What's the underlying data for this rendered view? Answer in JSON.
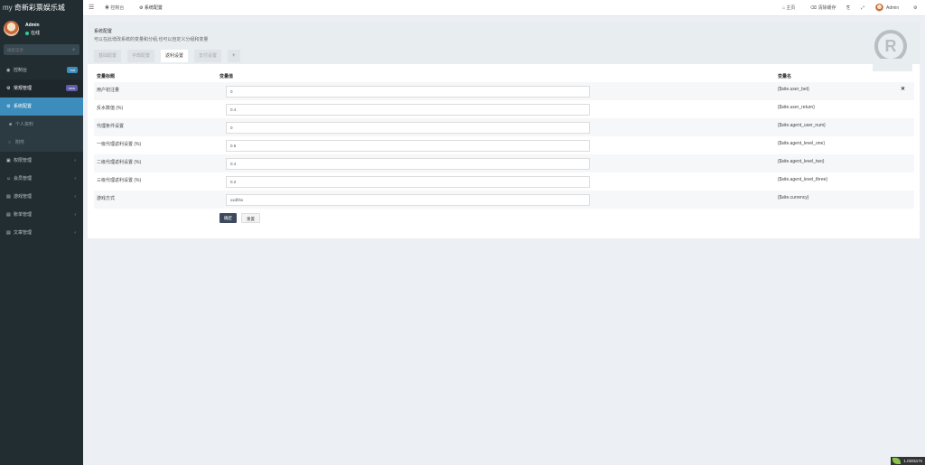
{
  "sidebar": {
    "logo_prefix": "my",
    "logo_text": "奇新彩票娱乐城",
    "user": {
      "name": "Admin",
      "status": "在线"
    },
    "search_placeholder": "搜索菜单",
    "items": [
      {
        "label": "控制台",
        "icon": "dashboard-icon",
        "badge": "hot",
        "badge_color": "#3c8dbc"
      },
      {
        "label": "常规管理",
        "icon": "cogs-icon",
        "badge": "new",
        "badge_color": "#605ca8"
      },
      {
        "label": "系统配置",
        "icon": "gear-icon"
      },
      {
        "label": "个人资料",
        "icon": "user-icon"
      },
      {
        "label": "附件",
        "icon": "circle-icon"
      },
      {
        "label": "权限管理",
        "icon": "group-icon"
      },
      {
        "label": "会员管理",
        "icon": "member-icon"
      },
      {
        "label": "游戏管理",
        "icon": "list-icon"
      },
      {
        "label": "账单管理",
        "icon": "list-icon"
      },
      {
        "label": "文章管理",
        "icon": "list-icon"
      }
    ]
  },
  "header": {
    "tabs": [
      {
        "label": "控制台",
        "icon": "dashboard-icon"
      },
      {
        "label": "系统配置",
        "icon": "gear-icon"
      }
    ],
    "right": {
      "home": "主页",
      "clear_cache": "清除缓存",
      "user": "Admin"
    }
  },
  "panel": {
    "title": "系统配置",
    "description": "可以在此增改系统的变量和分组,也可以自定义分组和变量",
    "tabs": [
      "基础配置",
      "字典配置",
      "返利设置",
      "支付设置",
      "+"
    ],
    "active_tab": "返利设置",
    "columns": {
      "title": "变量标题",
      "value": "变量值",
      "name": "变量名"
    },
    "rows": [
      {
        "label": "用户初注量",
        "value": "0",
        "var": "{$site.user_bet}"
      },
      {
        "label": "反水数值 (%)",
        "value": "0.4",
        "var": "{$site.user_return}"
      },
      {
        "label": "代理条件设置",
        "value": "0",
        "var": "{$site.agent_user_num}"
      },
      {
        "label": "一级代理返利设置 (%)",
        "value": "0.6",
        "var": "{$site.agent_level_one}"
      },
      {
        "label": "二级代理返利设置 (%)",
        "value": "0.4",
        "var": "{$site.agent_level_two}"
      },
      {
        "label": "三级代理返利设置 (%)",
        "value": "0.2",
        "var": "{$site.agent_level_three}"
      },
      {
        "label": "游戏方式",
        "value": "xxdhhx",
        "var": "{$site.currency}"
      }
    ],
    "buttons": {
      "submit": "确定",
      "reset": "重置"
    },
    "brand_letter": "R"
  },
  "runtime": "1.033117s",
  "colors": {
    "sidebar": "#222d32",
    "selected": "#3c8dbc",
    "primary_button": "#3d4a5c"
  }
}
